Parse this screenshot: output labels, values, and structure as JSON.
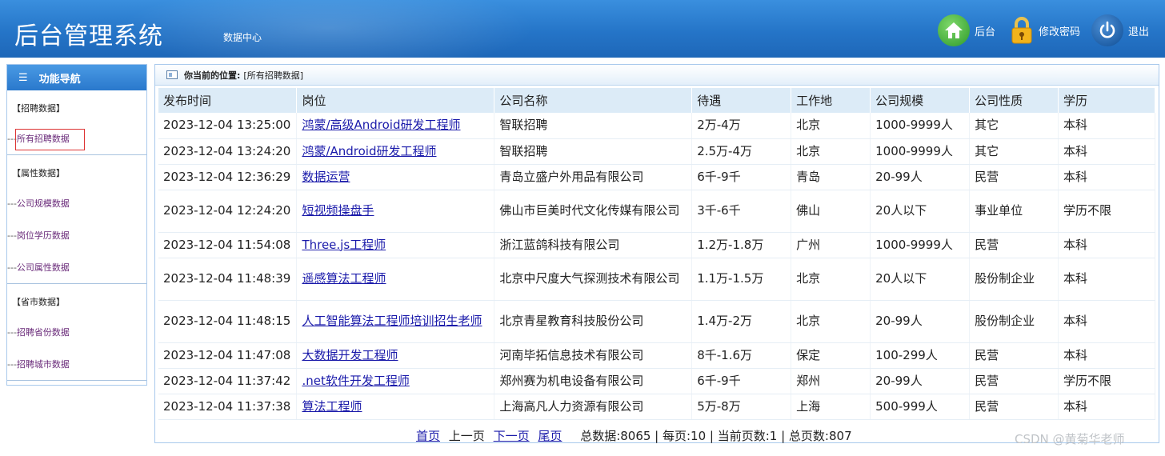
{
  "header": {
    "title": "后台管理系统",
    "subnav": "数据中心",
    "home_label": "后台",
    "password_label": "修改密码",
    "logout_label": "退出"
  },
  "sidebar": {
    "heading": "功能导航",
    "groups": [
      {
        "title": "【招聘数据】",
        "items": [
          "所有招聘数据"
        ]
      },
      {
        "title": "【属性数据】",
        "items": [
          "公司规模数据",
          "岗位学历数据",
          "公司属性数据"
        ]
      },
      {
        "title": "【省市数据】",
        "items": [
          "招聘省份数据",
          "招聘城市数据"
        ]
      }
    ],
    "prefix": "---"
  },
  "breadcrumb": {
    "label": "你当前的位置:",
    "current": "[所有招聘数据]"
  },
  "table": {
    "headers": [
      "发布时间",
      "岗位",
      "公司名称",
      "待遇",
      "工作地",
      "公司规模",
      "公司性质",
      "学历"
    ],
    "rows": [
      [
        "2023-12-04 13:25:00",
        "鸿蒙/高级Android研发工程师",
        "智联招聘",
        "2万-4万",
        "北京",
        "1000-9999人",
        "其它",
        "本科"
      ],
      [
        "2023-12-04 13:24:20",
        "鸿蒙/Android研发工程师",
        "智联招聘",
        "2.5万-4万",
        "北京",
        "1000-9999人",
        "其它",
        "本科"
      ],
      [
        "2023-12-04 12:36:29",
        "数据运营",
        "青岛立盛户外用品有限公司",
        "6千-9千",
        "青岛",
        "20-99人",
        "民营",
        "本科"
      ],
      [
        "2023-12-04 12:24:20",
        "短视频操盘手",
        "佛山市巨美时代文化传媒有限公司",
        "3千-6千",
        "佛山",
        "20人以下",
        "事业单位",
        "学历不限"
      ],
      [
        "2023-12-04 11:54:08",
        "Three.js工程师",
        "浙江蓝鸽科技有限公司",
        "1.2万-1.8万",
        "广州",
        "1000-9999人",
        "民营",
        "本科"
      ],
      [
        "2023-12-04 11:48:39",
        "遥感算法工程师",
        "北京中尺度大气探测技术有限公司",
        "1.1万-1.5万",
        "北京",
        "20人以下",
        "股份制企业",
        "本科"
      ],
      [
        "2023-12-04 11:48:15",
        "人工智能算法工程师培训招生老师",
        "北京青星教育科技股份公司",
        "1.4万-2万",
        "北京",
        "20-99人",
        "股份制企业",
        "本科"
      ],
      [
        "2023-12-04 11:47:08",
        "大数据开发工程师",
        "河南毕拓信息技术有限公司",
        "8千-1.6万",
        "保定",
        "100-299人",
        "民营",
        "本科"
      ],
      [
        "2023-12-04 11:37:42",
        ".net软件开发工程师",
        "郑州赛为机电设备有限公司",
        "6千-9千",
        "郑州",
        "20-99人",
        "民营",
        "学历不限"
      ],
      [
        "2023-12-04 11:37:38",
        "算法工程师",
        "上海高凡人力资源有限公司",
        "5万-8万",
        "上海",
        "500-999人",
        "民营",
        "本科"
      ]
    ]
  },
  "pager": {
    "first": "首页",
    "prev": "上一页",
    "next": "下一页",
    "last": "尾页",
    "stats": "总数据:8065 | 每页:10 | 当前页数:1 | 总页数:807"
  },
  "watermark": "CSDN @黄菊华老师"
}
